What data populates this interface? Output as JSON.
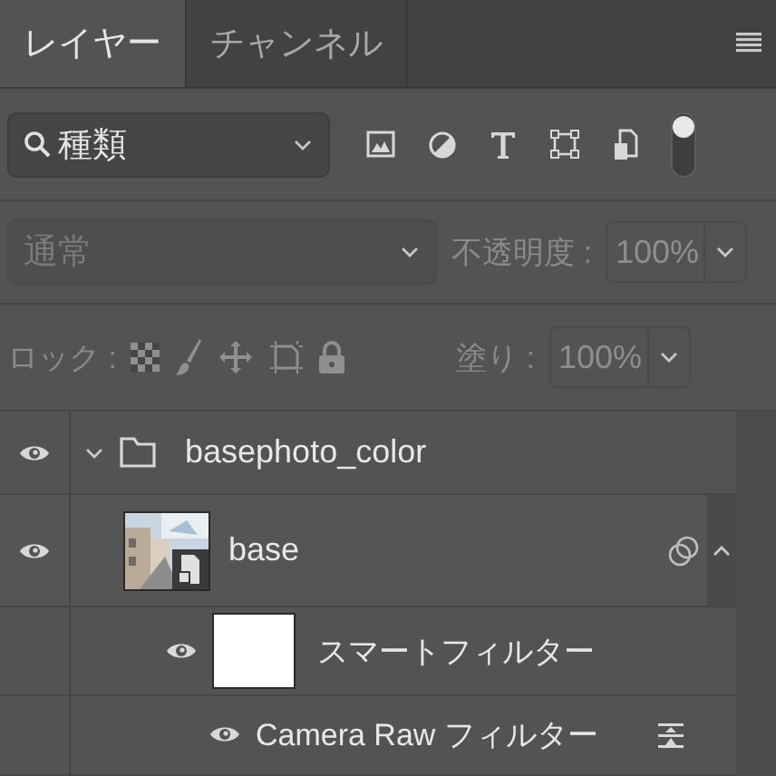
{
  "tabs": [
    {
      "label": "レイヤー",
      "selected": true
    },
    {
      "label": "チャンネル",
      "selected": false
    }
  ],
  "filter": {
    "value": "種類",
    "on": true
  },
  "blend": {
    "mode": "通常",
    "disabled": true,
    "opacity_label": "不透明度 :",
    "opacity": "100%"
  },
  "lock": {
    "label": "ロック :",
    "fill_label": "塗り :",
    "fill": "100%",
    "disabled": true
  },
  "layers": [
    {
      "kind": "group",
      "name": "basephoto_color",
      "visible": true,
      "expanded": true,
      "children": [
        {
          "kind": "smart",
          "name": "base",
          "visible": true,
          "expanded": true,
          "children": [
            {
              "kind": "filter_mask",
              "name": "スマートフィルター",
              "visible": true
            },
            {
              "kind": "filter",
              "name": "Camera Raw フィルター",
              "visible": true
            }
          ]
        }
      ]
    }
  ]
}
